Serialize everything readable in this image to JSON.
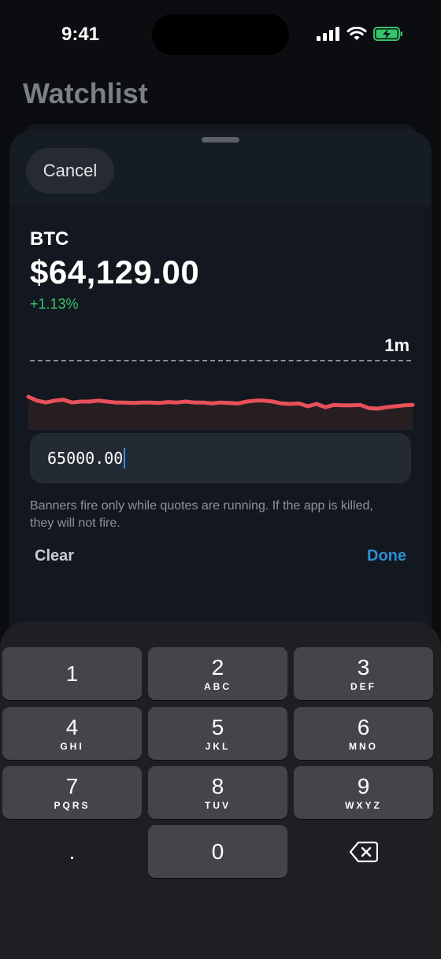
{
  "status_bar": {
    "time": "9:41",
    "icons": [
      "cellular-signal-icon",
      "wifi-icon",
      "battery-charging-icon"
    ]
  },
  "background": {
    "title": "Watchlist"
  },
  "sheet": {
    "cancel_label": "Cancel",
    "symbol": "BTC",
    "price": "$64,129.00",
    "change": "+1.13%",
    "change_color": "#36c56b",
    "range": "1m",
    "sparkline_color": "#e8505a",
    "sparkline_values": [
      0.3,
      0.38,
      0.42,
      0.38,
      0.36,
      0.42,
      0.4,
      0.4,
      0.38,
      0.4,
      0.42,
      0.42,
      0.43,
      0.42,
      0.42,
      0.43,
      0.41,
      0.42,
      0.4,
      0.42,
      0.42,
      0.44,
      0.42,
      0.43,
      0.44,
      0.4,
      0.38,
      0.38,
      0.4,
      0.44,
      0.45,
      0.44,
      0.5,
      0.45,
      0.52,
      0.47,
      0.48,
      0.48,
      0.47,
      0.54,
      0.55,
      0.52,
      0.5,
      0.48,
      0.47
    ],
    "input_value": "65000.00",
    "note": "Banners fire only while quotes are running. If the app is killed, they will not fire.",
    "clear_label": "Clear",
    "done_label": "Done",
    "accent_color": "#2b8fd4"
  },
  "keyboard": {
    "keys": [
      {
        "num": "1",
        "letters": ""
      },
      {
        "num": "2",
        "letters": "ABC"
      },
      {
        "num": "3",
        "letters": "DEF"
      },
      {
        "num": "4",
        "letters": "GHI"
      },
      {
        "num": "5",
        "letters": "JKL"
      },
      {
        "num": "6",
        "letters": "MNO"
      },
      {
        "num": "7",
        "letters": "PQRS"
      },
      {
        "num": "8",
        "letters": "TUV"
      },
      {
        "num": "9",
        "letters": "WXYZ"
      },
      {
        "num": ".",
        "letters": ""
      },
      {
        "num": "0",
        "letters": ""
      }
    ],
    "delete_icon": "backspace-icon"
  }
}
